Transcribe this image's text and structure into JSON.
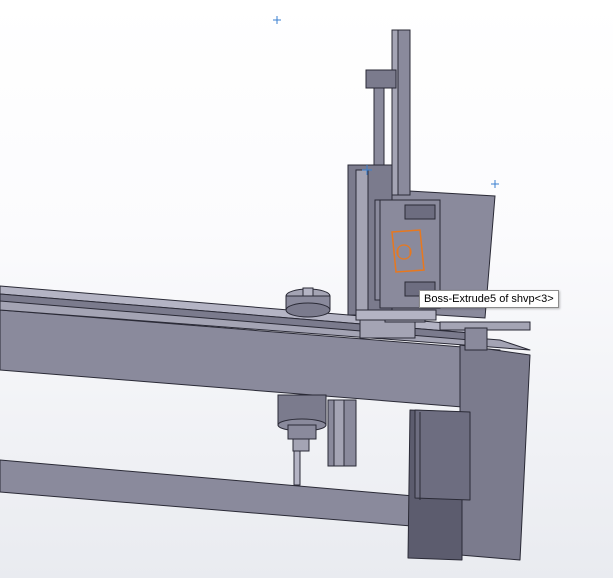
{
  "viewport": {
    "background_top": "#ffffff",
    "background_bottom": "#e9ebf0"
  },
  "model": {
    "body_color": "#8a8a9c",
    "dark_color": "#5c5c6e",
    "light_color": "#a4a4b4",
    "edge_color": "#2a2a36",
    "selection_color": "#e8781e",
    "origin_marker_color": "#3a7fd0"
  },
  "tooltip": {
    "text": "Boss-Extrude5 of shvp<3>"
  }
}
